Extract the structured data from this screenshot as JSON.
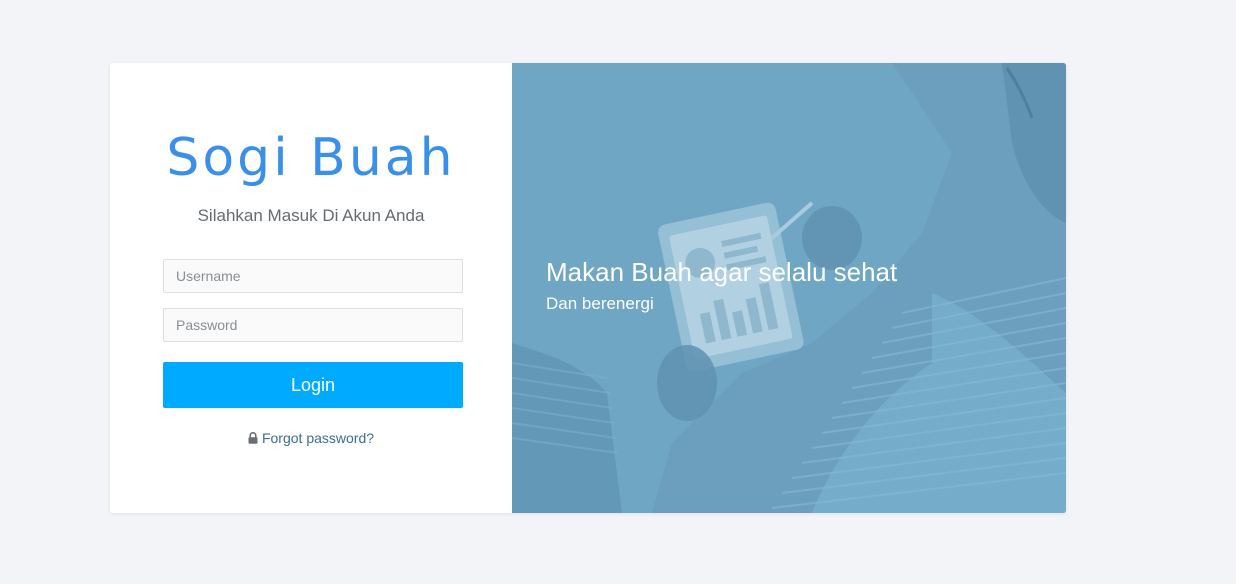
{
  "brand": {
    "logo_text": "Sogi Buah",
    "tagline": "Silahkan Masuk Di Akun Anda"
  },
  "form": {
    "username": {
      "value": "",
      "placeholder": "Username"
    },
    "password": {
      "value": "",
      "placeholder": "Password"
    },
    "login_label": "Login",
    "forgot_label": "Forgot password?"
  },
  "hero": {
    "title": "Makan Buah agar selalu sehat",
    "subtitle": "Dan berenergi"
  },
  "icons": {
    "forgot": "lock-icon"
  },
  "colors": {
    "page_background": "#f3f4f8",
    "logo": "#3a8fe8",
    "login_button": "#00aaff",
    "link": "#3d6e91",
    "hero_overlay": "#6ea6c4"
  }
}
